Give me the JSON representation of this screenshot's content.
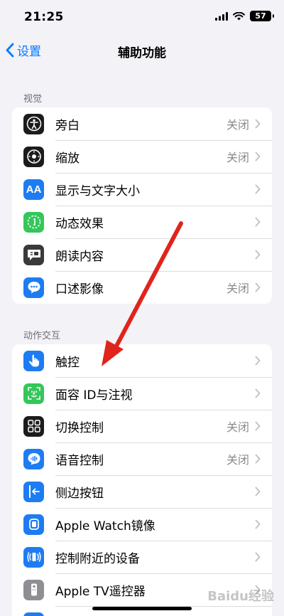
{
  "status_bar": {
    "time": "21:25",
    "battery": "57"
  },
  "nav": {
    "back_label": "设置",
    "title": "辅助功能"
  },
  "sections": [
    {
      "header": "视觉",
      "items": [
        {
          "label": "旁白",
          "value": "关闭",
          "icon": "voiceover-icon",
          "color": "#1c1c1e"
        },
        {
          "label": "缩放",
          "value": "关闭",
          "icon": "zoom-icon",
          "color": "#1c1c1e"
        },
        {
          "label": "显示与文字大小",
          "value": "",
          "icon": "text-size-icon",
          "color": "#1e7cf2"
        },
        {
          "label": "动态效果",
          "value": "",
          "icon": "motion-icon",
          "color": "#34c759"
        },
        {
          "label": "朗读内容",
          "value": "",
          "icon": "speech-bubble-icon",
          "color": "#3a3a3c"
        },
        {
          "label": "口述影像",
          "value": "关闭",
          "icon": "audio-description-icon",
          "color": "#1e7cf2"
        }
      ]
    },
    {
      "header": "动作交互",
      "items": [
        {
          "label": "触控",
          "value": "",
          "icon": "hand-icon",
          "color": "#1e7cf2"
        },
        {
          "label": "面容 ID与注视",
          "value": "",
          "icon": "face-id-icon",
          "color": "#34c759"
        },
        {
          "label": "切换控制",
          "value": "关闭",
          "icon": "switch-control-icon",
          "color": "#1c1c1e"
        },
        {
          "label": "语音控制",
          "value": "关闭",
          "icon": "voice-control-icon",
          "color": "#1e7cf2"
        },
        {
          "label": "侧边按钮",
          "value": "",
          "icon": "side-button-icon",
          "color": "#1e7cf2"
        },
        {
          "label": "Apple Watch镜像",
          "value": "",
          "icon": "watch-icon",
          "color": "#1e7cf2"
        },
        {
          "label": "控制附近的设备",
          "value": "",
          "icon": "nearby-devices-icon",
          "color": "#1e7cf2"
        },
        {
          "label": "Apple TV遥控器",
          "value": "",
          "icon": "tv-remote-icon",
          "color": "#8e8e93"
        }
      ]
    }
  ],
  "watermark": "Baidu经验"
}
